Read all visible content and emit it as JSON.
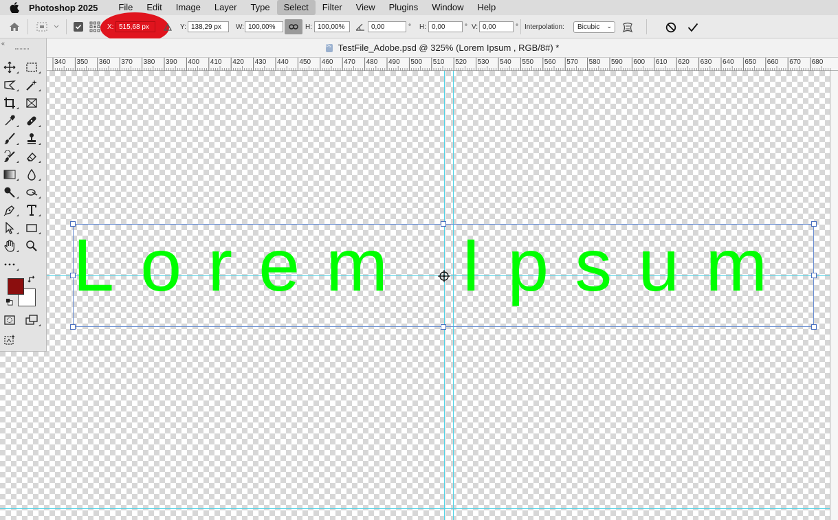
{
  "app": {
    "name": "Photoshop 2025"
  },
  "menu": [
    "File",
    "Edit",
    "Image",
    "Layer",
    "Type",
    "Select",
    "Filter",
    "View",
    "Plugins",
    "Window",
    "Help"
  ],
  "options": {
    "x_label": "X:",
    "x_value": "515,68 px",
    "y_label": "Y:",
    "y_value": "138,29 px",
    "w_label": "W:",
    "w_value": "100,00%",
    "h_label": "H:",
    "h_value": "100,00%",
    "angle_value": "0,00",
    "angle_unit": "°",
    "hskew_label": "H:",
    "hskew_value": "0,00",
    "hskew_unit": "°",
    "vskew_label": "V:",
    "vskew_value": "0,00",
    "vskew_unit": "°",
    "interp_label": "Interpolation:",
    "interp_value": "Bicubic"
  },
  "document": {
    "title": "TestFile_Adobe.psd @ 325% (Lorem Ipsum , RGB/8#) *"
  },
  "ruler": {
    "labels": [
      "340",
      "350",
      "360",
      "370",
      "380",
      "390",
      "400",
      "410",
      "420",
      "430",
      "440",
      "450",
      "460",
      "470",
      "480",
      "490",
      "500",
      "510",
      "520",
      "530",
      "540",
      "550",
      "560",
      "570",
      "580",
      "590",
      "600",
      "610",
      "620",
      "630",
      "640",
      "650",
      "660",
      "670",
      "680"
    ]
  },
  "layer_text": "Lorem Ipsum",
  "colors": {
    "foreground": "#8b0e0e",
    "background": "#ffffff",
    "text": "#00ff00",
    "guide": "#4fd3e6",
    "highlight": "#e0141e"
  }
}
